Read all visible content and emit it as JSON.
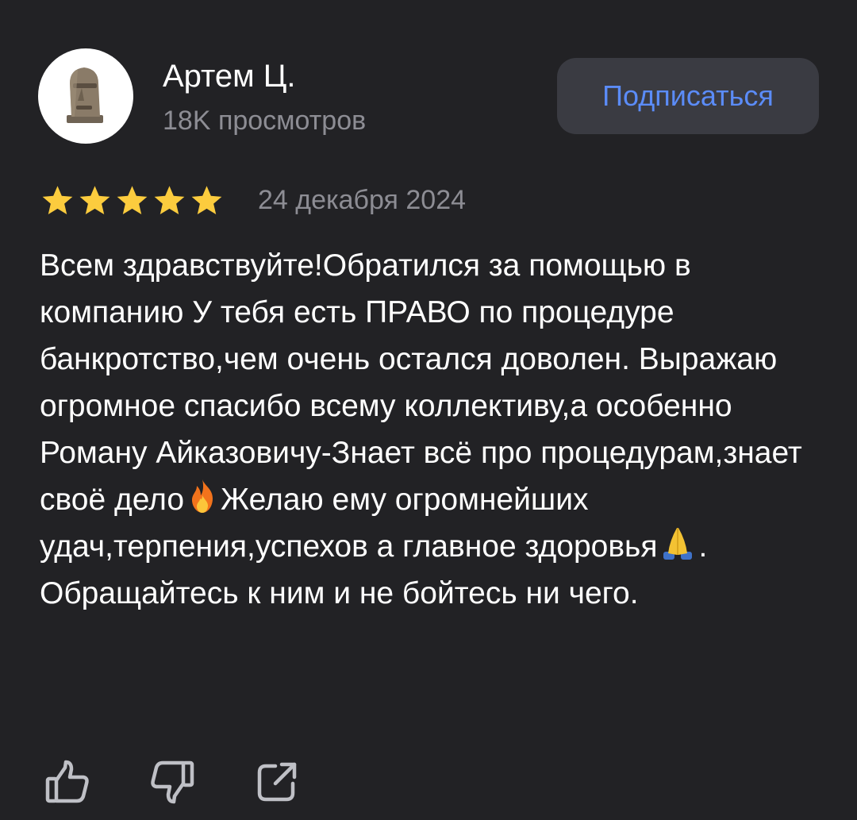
{
  "author": {
    "name": "Артем Ц.",
    "views": "18K просмотров",
    "avatar_icon": "moai-icon"
  },
  "subscribe": {
    "label": "Подписаться",
    "color": "#5b8cf8"
  },
  "review": {
    "rating": 5,
    "rating_max": 5,
    "date": "24 декабря 2024",
    "text_part1": "Всем здравствуйте!Обратился за помощью в компанию У тебя есть ПРАВО по процедуре банкротство,чем очень остался доволен. Выражаю огромное спасибо всему коллективу,а особенно Роману Айказовичу-Знает всё про процедурам,знает своё дело",
    "emoji_1": "fire-emoji",
    "text_part2": "Желаю ему огромнейших удач,терпения,успехов а главное здоровья",
    "emoji_2": "folded-hands-emoji",
    "text_part3": ". Обращайтесь к ним и не бойтесь ни чего."
  },
  "actions": [
    {
      "icon": "thumbs-up-icon"
    },
    {
      "icon": "thumbs-down-icon"
    },
    {
      "icon": "share-icon"
    }
  ],
  "colors": {
    "background": "#222225",
    "star": "#fccc3e",
    "secondary_text": "#8d8d94",
    "button_bg": "#3a3b42"
  }
}
